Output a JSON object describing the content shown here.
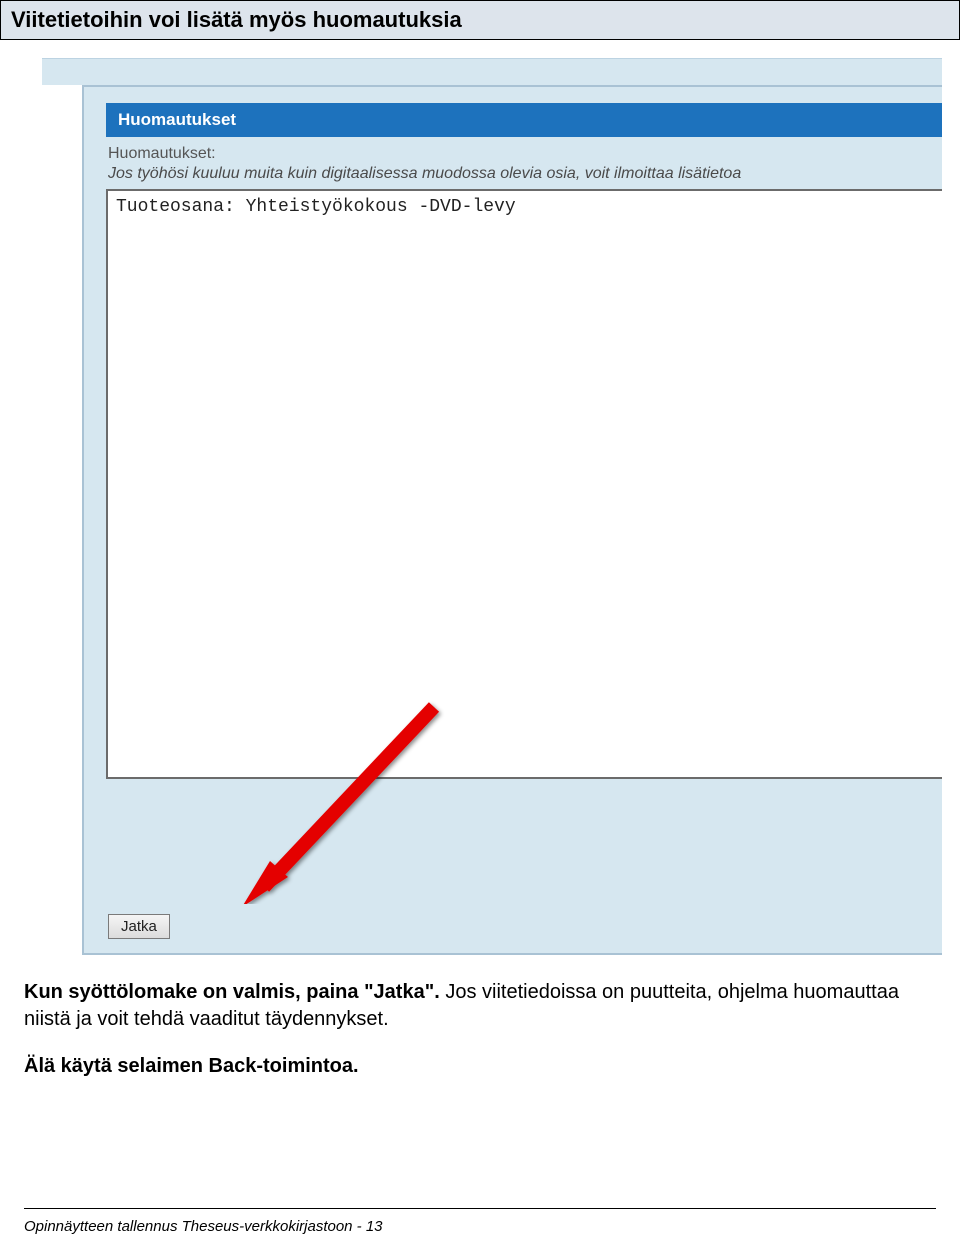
{
  "title": "Viitetietoihin voi lisätä myös huomautuksia",
  "screenshot": {
    "section_header": "Huomautukset",
    "field_label": "Huomautukset:",
    "field_help": "Jos työhösi kuuluu muita kuin digitaalisessa muodossa olevia osia, voit ilmoittaa lisätietoa",
    "textarea_value": "Tuoteosana: Yhteistyökokous -DVD-levy",
    "button_label": "Jatka"
  },
  "body": {
    "p1_bold": "Kun syöttölomake on valmis, paina \"Jatka\".",
    "p1_rest": " Jos viitetiedoissa on puutteita, ohjelma huomauttaa niistä ja voit tehdä vaaditut täydennykset.",
    "p2_bold": "Älä käytä selaimen Back-toimintoa."
  },
  "footer": "Opinnäytteen tallennus Theseus-verkkokirjastoon  - 13"
}
